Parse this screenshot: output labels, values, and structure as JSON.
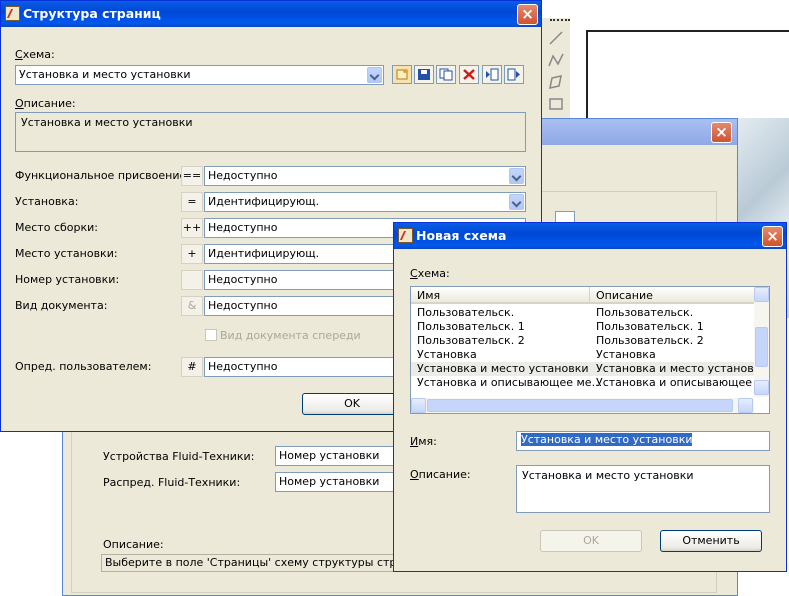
{
  "structure_dialog": {
    "title": "Структура страниц",
    "scheme_label": "Схема:",
    "scheme_value": "Установка и место установки",
    "description_label": "Описание:",
    "description_value": "Установка и место установки",
    "rows": [
      {
        "label": "Функциональное присвоение:",
        "symbol": "==",
        "value": "Недоступно"
      },
      {
        "label": "Установка:",
        "symbol": "=",
        "value": "Идентифицирующ."
      },
      {
        "label": "Место сборки:",
        "symbol": "++",
        "value": "Недоступно"
      },
      {
        "label": "Место установки:",
        "symbol": "+",
        "value": "Идентифицирующ."
      },
      {
        "label": "Номер установки:",
        "symbol": "",
        "value": "Недоступно"
      },
      {
        "label": "Вид документа:",
        "symbol": "&",
        "value": "Недоступно"
      }
    ],
    "doc_type_front_label": "Вид документа спереди",
    "user_defined_label": "Опред. пользователем:",
    "user_defined_symbol": "#",
    "user_defined_value": "Недоступно",
    "ok_label": "OK"
  },
  "background_dialog": {
    "rows": [
      {
        "label": "Устройства Fluid-Техники:",
        "value": "Номер установки"
      },
      {
        "label": "Распред. Fluid-Техники:",
        "value": "Номер установки"
      }
    ],
    "description_label": "Описание:",
    "description_value": "Выберите в поле 'Страницы' схему структуры страниц."
  },
  "new_scheme_dialog": {
    "title": "Новая схема",
    "scheme_label": "Схема:",
    "columns": [
      "Имя",
      "Описание"
    ],
    "items": [
      {
        "name": "Пользовательск.",
        "description": "Пользовательск."
      },
      {
        "name": "Пользовательск. 1",
        "description": "Пользовательск. 1"
      },
      {
        "name": "Пользовательск. 2",
        "description": "Пользовательск. 2"
      },
      {
        "name": "Установка",
        "description": "Установка"
      },
      {
        "name": "Установка и место установки",
        "description": "Установка и место установки"
      },
      {
        "name": "Установка и описывающее ме...",
        "description": "Установка и описывающее ме"
      }
    ],
    "name_label": "Имя:",
    "name_value": "Установка и место установки",
    "description_label": "Описание:",
    "description_value": "Установка и место установки",
    "ok_label": "OK",
    "cancel_label": "Отменить"
  }
}
